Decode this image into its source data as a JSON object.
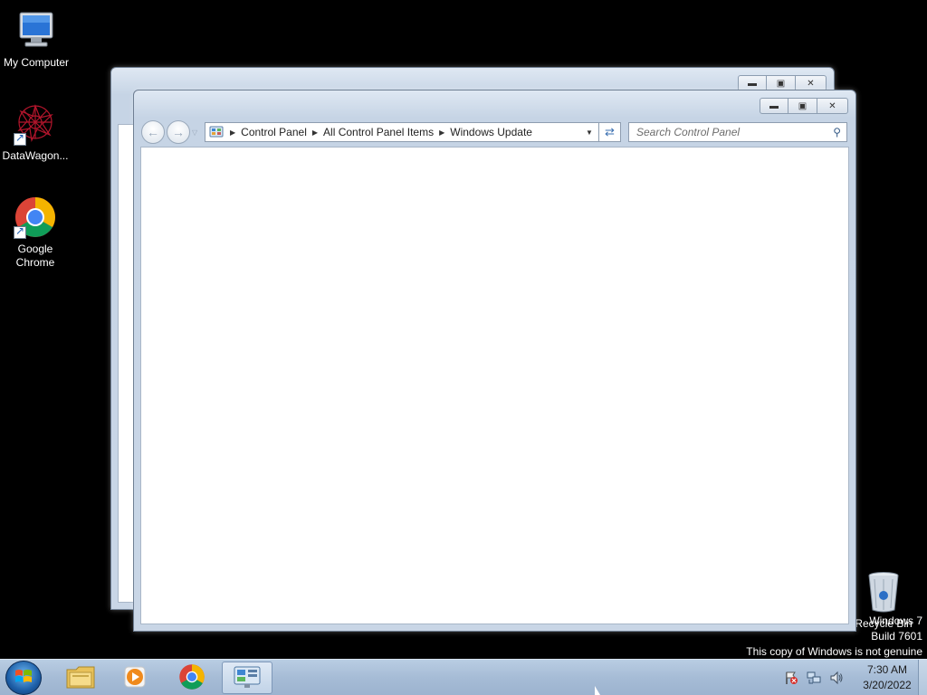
{
  "desktop": {
    "icons": [
      {
        "label": "My Computer",
        "icon": "computer-icon"
      },
      {
        "label": "DataWagon...",
        "icon": "datawagon-icon",
        "shortcut": true
      },
      {
        "label": "Google Chrome",
        "icon": "chrome-icon",
        "shortcut": true
      },
      {
        "label": "Recycle Bin",
        "icon": "recycle-bin-icon"
      }
    ]
  },
  "window": {
    "breadcrumbs": [
      "Control Panel",
      "All Control Panel Items",
      "Windows Update"
    ],
    "search_placeholder": "Search Control Panel",
    "caption_buttons": {
      "minimize": "minimize-icon",
      "maximize": "maximize-icon",
      "close": "close-icon"
    }
  },
  "watermark": {
    "line1": "Windows 7",
    "line2": "Build 7601",
    "line3": "This copy of Windows is not genuine"
  },
  "taskbar": {
    "apps": [
      "windows-explorer-icon",
      "media-player-icon",
      "chrome-icon",
      "control-panel-icon"
    ],
    "active_app": "control-panel-icon",
    "clock": {
      "time": "7:30 AM",
      "date": "3/20/2022"
    }
  },
  "colors": {
    "desktop_bg": "#000000",
    "taskbar": "#a6bcd6",
    "window_frame": "#c9d6e6"
  }
}
